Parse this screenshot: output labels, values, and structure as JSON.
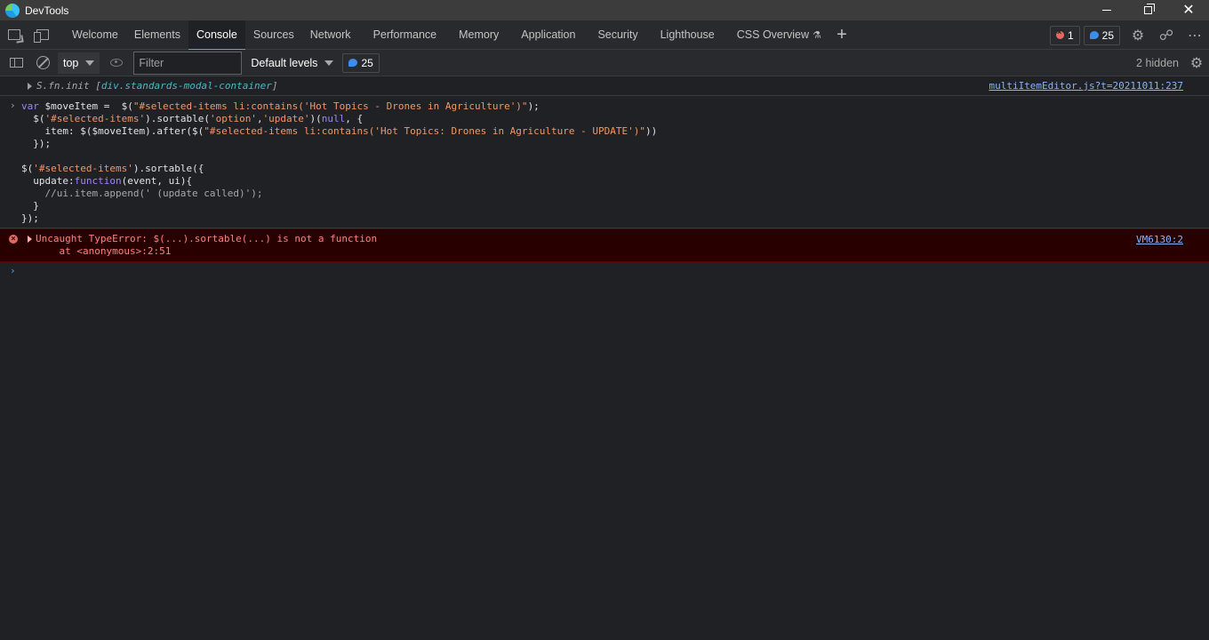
{
  "window": {
    "title": "DevTools"
  },
  "tabs": [
    "Welcome",
    "Elements",
    "Console",
    "Sources",
    "Network",
    "Performance",
    "Memory",
    "Application",
    "Security",
    "Lighthouse",
    "CSS Overview"
  ],
  "active_tab": "Console",
  "badges": {
    "errors": "1",
    "messages": "25"
  },
  "toolbar": {
    "context": "top",
    "filter_placeholder": "Filter",
    "levels": "Default levels",
    "message_count": "25",
    "hidden": "2 hidden"
  },
  "console": {
    "prev_message": {
      "prefix": "S.fn.init [",
      "node": "div.standards-modal-container",
      "suffix": "]",
      "source": "multiItemEditor.js?t=20211011:237"
    },
    "command": {
      "lines": [
        [
          [
            "k",
            "var "
          ],
          [
            "v",
            "$moveItem =  $("
          ],
          [
            "s",
            "\"#selected-items li:contains('Hot Topics - Drones in Agriculture')\""
          ],
          [
            "v",
            ");"
          ]
        ],
        [
          [
            "v",
            "  $("
          ],
          [
            "s",
            "'#selected-items'"
          ],
          [
            "v",
            ").sortable("
          ],
          [
            "s",
            "'option'"
          ],
          [
            "v",
            ","
          ],
          [
            "s",
            "'update'"
          ],
          [
            "v",
            ")("
          ],
          [
            "k",
            "null"
          ],
          [
            "v",
            ", {"
          ]
        ],
        [
          [
            "v",
            "    item: $($moveItem).after($("
          ],
          [
            "s",
            "\"#selected-items li:contains('Hot Topics: Drones in Agriculture - UPDATE')\""
          ],
          [
            "v",
            "))"
          ]
        ],
        [
          [
            "v",
            "  });"
          ]
        ],
        [
          [
            "v",
            ""
          ]
        ],
        [
          [
            "v",
            "$("
          ],
          [
            "s",
            "'#selected-items'"
          ],
          [
            "v",
            ").sortable({"
          ]
        ],
        [
          [
            "v",
            "  update:"
          ],
          [
            "k",
            "function"
          ],
          [
            "v",
            "(event, ui){"
          ]
        ],
        [
          [
            "c",
            "    //ui.item.append(' (update called)');"
          ]
        ],
        [
          [
            "v",
            "  }"
          ]
        ],
        [
          [
            "v",
            "});"
          ]
        ]
      ]
    },
    "error": {
      "line1": "Uncaught TypeError: $(...).sortable(...) is not a function",
      "line2": "    at <anonymous>:2:51",
      "source": "VM6130:2"
    }
  }
}
